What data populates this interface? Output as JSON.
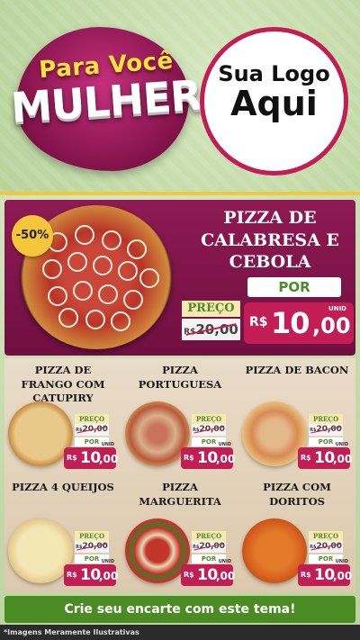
{
  "header": {
    "badge_line1": "Para Você",
    "badge_line2": "MULHER",
    "logo_line1": "Sua Logo",
    "logo_line2": "Aqui"
  },
  "featured": {
    "discount": "-50%",
    "title": "PIZZA DE CALABRESA E CEBOLA",
    "preco_label": "PREÇO",
    "old_currency": "R$",
    "old_price": "20,00",
    "por_label": "POR",
    "unid": "UNID",
    "new_currency": "R$",
    "new_int": "10",
    "new_cents": ",00"
  },
  "products": [
    {
      "name": "PIZZA DE FRANGO COM CATUPIRY",
      "preco_label": "PREÇO",
      "old_currency": "R$",
      "old_price": "20,00",
      "por_label": "POR",
      "unid": "UNID",
      "new_currency": "R$",
      "new_int": "10",
      "new_cents": ",00"
    },
    {
      "name": "PIZZA PORTUGUESA",
      "preco_label": "PREÇO",
      "old_currency": "R$",
      "old_price": "20,00",
      "por_label": "POR",
      "unid": "UNID",
      "new_currency": "R$",
      "new_int": "10",
      "new_cents": ",00"
    },
    {
      "name": "PIZZA DE BACON",
      "preco_label": "PREÇO",
      "old_currency": "R$",
      "old_price": "20,00",
      "por_label": "POR",
      "unid": "UNID",
      "new_currency": "R$",
      "new_int": "10",
      "new_cents": ",00"
    },
    {
      "name": "PIZZA 4 QUEIJOS",
      "preco_label": "PREÇO",
      "old_currency": "R$",
      "old_price": "20,00",
      "por_label": "POR",
      "unid": "UNID",
      "new_currency": "R$",
      "new_int": "10",
      "new_cents": ",00"
    },
    {
      "name": "PIZZA MARGUERITA",
      "preco_label": "PREÇO",
      "old_currency": "R$",
      "old_price": "20,00",
      "por_label": "POR",
      "unid": "UNID",
      "new_currency": "R$",
      "new_int": "10",
      "new_cents": ",00"
    },
    {
      "name": "PIZZA COM DORITOS",
      "preco_label": "PREÇO",
      "old_currency": "R$",
      "old_price": "20,00",
      "por_label": "POR",
      "unid": "UNID",
      "new_currency": "R$",
      "new_int": "10",
      "new_cents": ",00"
    }
  ],
  "cta": "Crie seu encarte com este tema!",
  "footer": "*Imagens Meramente Ilustrativas",
  "colors": {
    "accent": "#c21e55",
    "badge": "#8e1a53",
    "green": "#4b8b23",
    "gold": "#f6c63a"
  }
}
